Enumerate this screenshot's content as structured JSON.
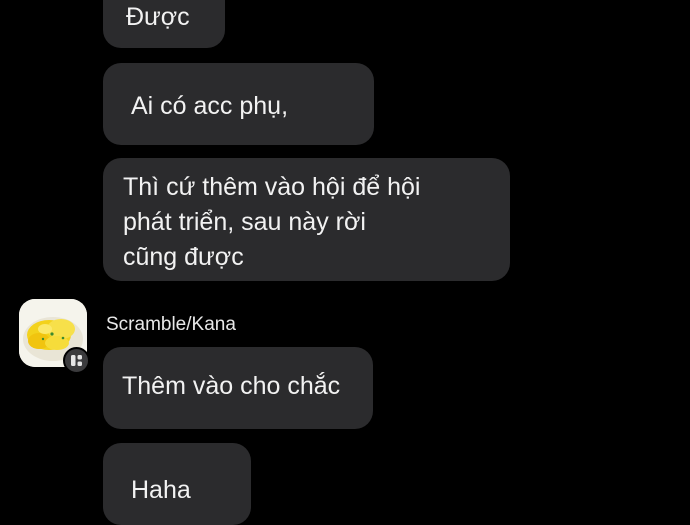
{
  "chat": {
    "messages": [
      {
        "text": "Được"
      },
      {
        "text": "Ai có acc phụ,"
      },
      {
        "text": "Thì cứ thêm vào hội để hội\nphát triển, sau này rời\ncũng được"
      },
      {
        "text": "Thêm vào cho chắc"
      },
      {
        "text": "Haha"
      }
    ],
    "sender": {
      "name": "Scramble/Kana",
      "avatar_icon": "scrambled-egg-avatar",
      "badge_icon": "group-badge-icon"
    }
  },
  "colors": {
    "background": "#000000",
    "bubble": "#2b2b2d",
    "text": "#f2f2f2"
  }
}
